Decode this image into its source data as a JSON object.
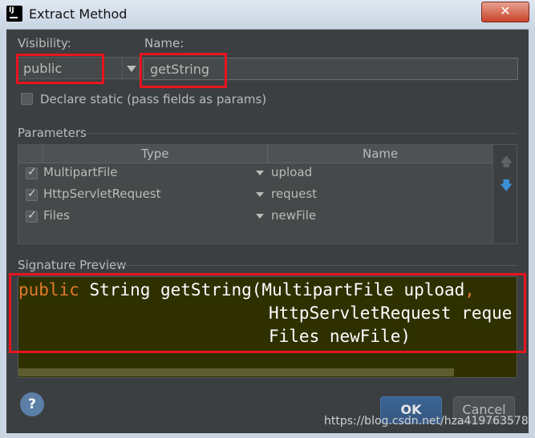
{
  "window": {
    "title": "Extract Method",
    "close_glyph": "✕",
    "app_icon_text": "IJ"
  },
  "visibility": {
    "label": "Visibility:",
    "value": "public"
  },
  "name": {
    "label": "Name:",
    "value": "getString"
  },
  "declare_static": {
    "label": "Declare static (pass fields as params)",
    "checked": false
  },
  "parameters": {
    "label": "Parameters",
    "columns": [
      "Type",
      "Name"
    ],
    "rows": [
      {
        "checked": true,
        "type": "MultipartFile",
        "name": "upload"
      },
      {
        "checked": true,
        "type": "HttpServletRequest",
        "name": "request"
      },
      {
        "checked": true,
        "type": "Files",
        "name": "newFile"
      }
    ],
    "move_up_icon": "arrow-up-icon",
    "move_down_icon": "arrow-down-icon"
  },
  "signature_preview": {
    "label": "Signature Preview",
    "line1_keyword": "public",
    "line1_rest": " String getString(MultipartFile upload",
    "line1_comma": ",",
    "line2": "HttpServletRequest reque",
    "line3": "Files newFile)"
  },
  "buttons": {
    "help": "?",
    "ok": "OK",
    "cancel": "Cancel"
  },
  "watermark": "https://blog.csdn.net/hza419763578",
  "colors": {
    "highlight_box": "#e8141e",
    "keyword": "#e07a28",
    "preview_bg": "#2e3000",
    "ok_button": "#365880"
  }
}
